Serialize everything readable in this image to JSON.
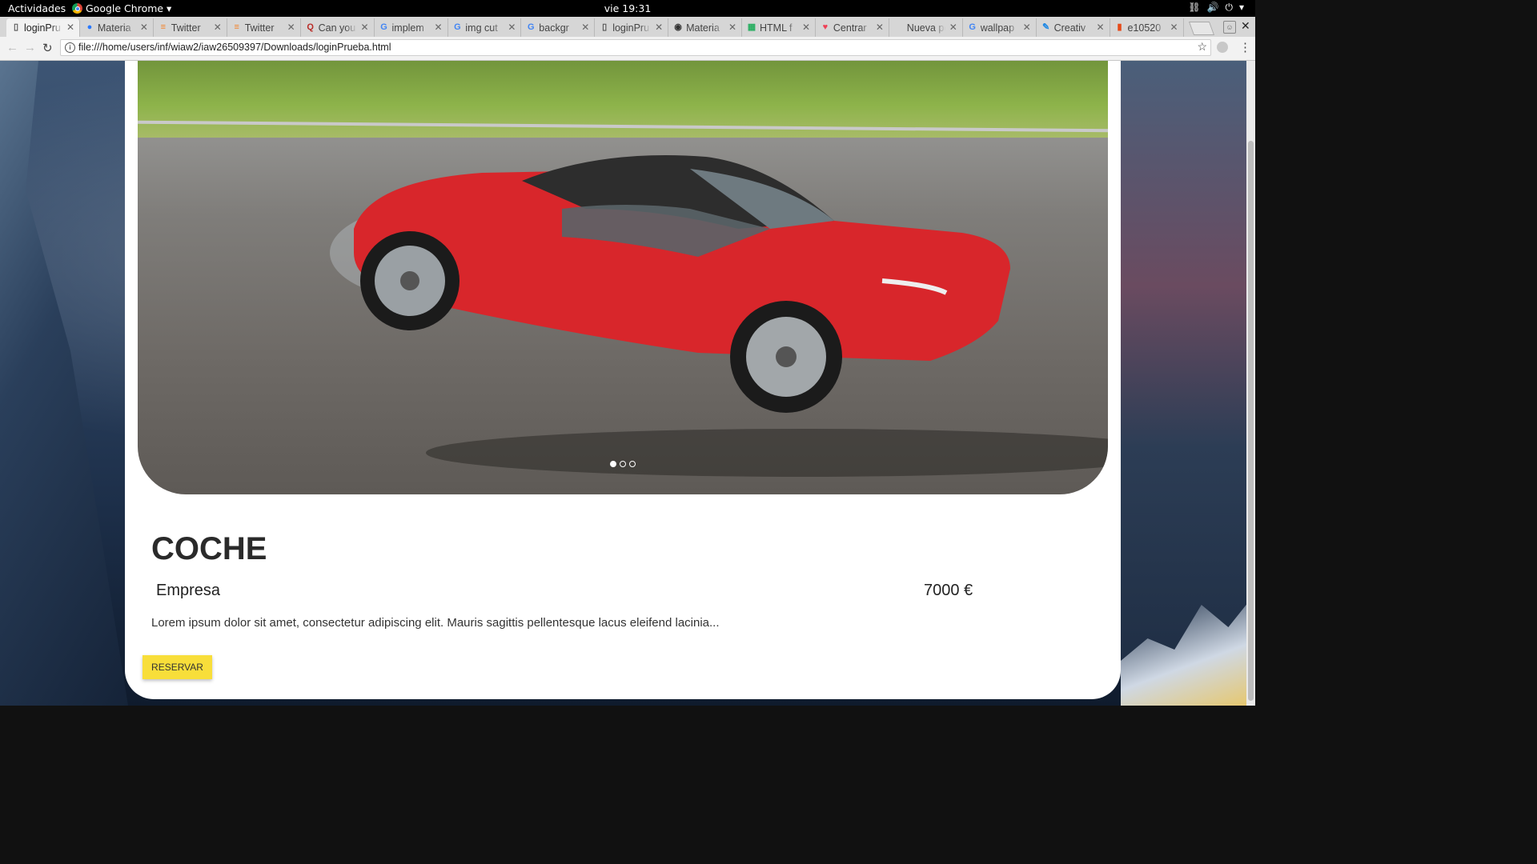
{
  "system": {
    "activities": "Actividades",
    "app_name": "Google Chrome ▾",
    "clock": "vie 19:31"
  },
  "browser": {
    "tabs": [
      {
        "title": "loginPru",
        "icon": "page-icon",
        "active": true
      },
      {
        "title": "Materia",
        "icon": "material-icon"
      },
      {
        "title": "Twitter",
        "icon": "stackoverflow-icon"
      },
      {
        "title": "Twitter",
        "icon": "stackoverflow-icon"
      },
      {
        "title": "Can you",
        "icon": "quora-icon"
      },
      {
        "title": "implem",
        "icon": "google-icon"
      },
      {
        "title": "img cut",
        "icon": "google-icon"
      },
      {
        "title": "backgr",
        "icon": "google-icon"
      },
      {
        "title": "loginPru",
        "icon": "page-icon"
      },
      {
        "title": "Materia",
        "icon": "materializecss-icon"
      },
      {
        "title": "HTML f",
        "icon": "html-icon"
      },
      {
        "title": "Centrar",
        "icon": "pocket-icon"
      },
      {
        "title": "Nueva pes",
        "icon": "none"
      },
      {
        "title": "wallpap",
        "icon": "google-icon"
      },
      {
        "title": "Creativ",
        "icon": "creative-icon"
      },
      {
        "title": "e10520",
        "icon": "bookmark-icon"
      }
    ],
    "url": "file:///home/users/inf/wiaw2/iaw26509397/Downloads/loginPrueba.html"
  },
  "product": {
    "title": "COCHE",
    "company": "Empresa",
    "price": "7000 €",
    "description": "Lorem ipsum dolor sit amet, consectetur adipiscing elit. Mauris sagittis pellentesque lacus eleifend lacinia...",
    "button_label": "RESERVAR"
  },
  "carousel": {
    "slide_count": 3,
    "active_index": 0
  },
  "colors": {
    "accent_button": "#f8de3a",
    "car_red": "#d8262b"
  }
}
